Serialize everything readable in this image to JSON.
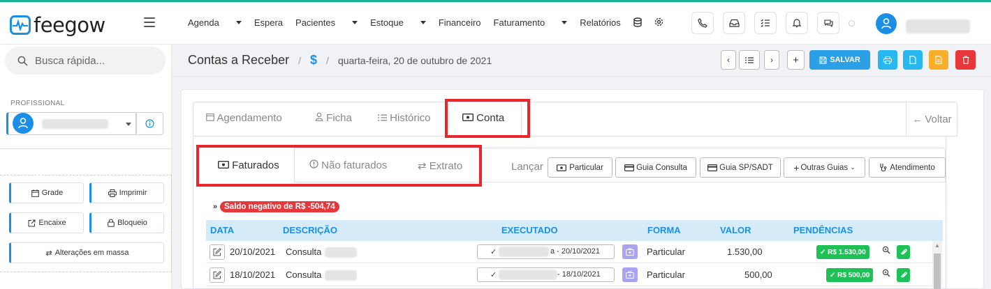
{
  "app": {
    "name": "feegow",
    "accent": "#1b8fe6",
    "top_line": "#1ab394"
  },
  "nav": {
    "agenda": "Agenda",
    "espera": "Espera",
    "pacientes": "Pacientes",
    "estoque": "Estoque",
    "financeiro": "Financeiro",
    "faturamento": "Faturamento",
    "relatorios": "Relatórios"
  },
  "header_icons": [
    "phone-icon",
    "inbox-icon",
    "checklist-icon",
    "bell-icon",
    "chat-icon"
  ],
  "sidebar": {
    "search_placeholder": "Busca rápida...",
    "profissional_label": "PROFISSIONAL",
    "grade": "Grade",
    "imprimir": "Imprimir",
    "encaixe": "Encaixe",
    "bloqueio": "Bloqueio",
    "alteracoes": "Alterações em massa"
  },
  "page": {
    "title": "Contas a Receber",
    "currency_symbol": "$",
    "date": "quarta-feira, 20 de outubro de 2021",
    "salvar": "SALVAR"
  },
  "tabs": {
    "agendamento": "Agendamento",
    "ficha": "Ficha",
    "historico": "Histórico",
    "conta": "Conta",
    "voltar": "Voltar"
  },
  "subtabs": {
    "faturados": "Faturados",
    "nao_faturados": "Não faturados",
    "extrato": "Extrato"
  },
  "lancar": {
    "label": "Lançar",
    "particular": "Particular",
    "guia_consulta": "Guia Consulta",
    "guia_sp": "Guia SP/SADT",
    "outras": "Outras Guias",
    "atendimento": "Atendimento"
  },
  "saldo": "Saldo negativo de R$ -504,74",
  "table": {
    "headers": {
      "data": "DATA",
      "descricao": "DESCRIÇÃO",
      "executado": "EXECUTADO",
      "forma": "FORMA",
      "valor": "VALOR",
      "pendencias": "PENDÊNCIAS"
    },
    "rows": [
      {
        "data": "20/10/2021",
        "descricao": "Consulta",
        "executado": "a - 20/10/2021",
        "forma": "Particular",
        "valor": "1.530,00",
        "pendencia": "R$ 1.530,00"
      },
      {
        "data": "18/10/2021",
        "descricao": "Consulta",
        "executado": "- 18/10/2021",
        "forma": "Particular",
        "valor": "500,00",
        "pendencia": "R$ 500,00"
      }
    ]
  }
}
